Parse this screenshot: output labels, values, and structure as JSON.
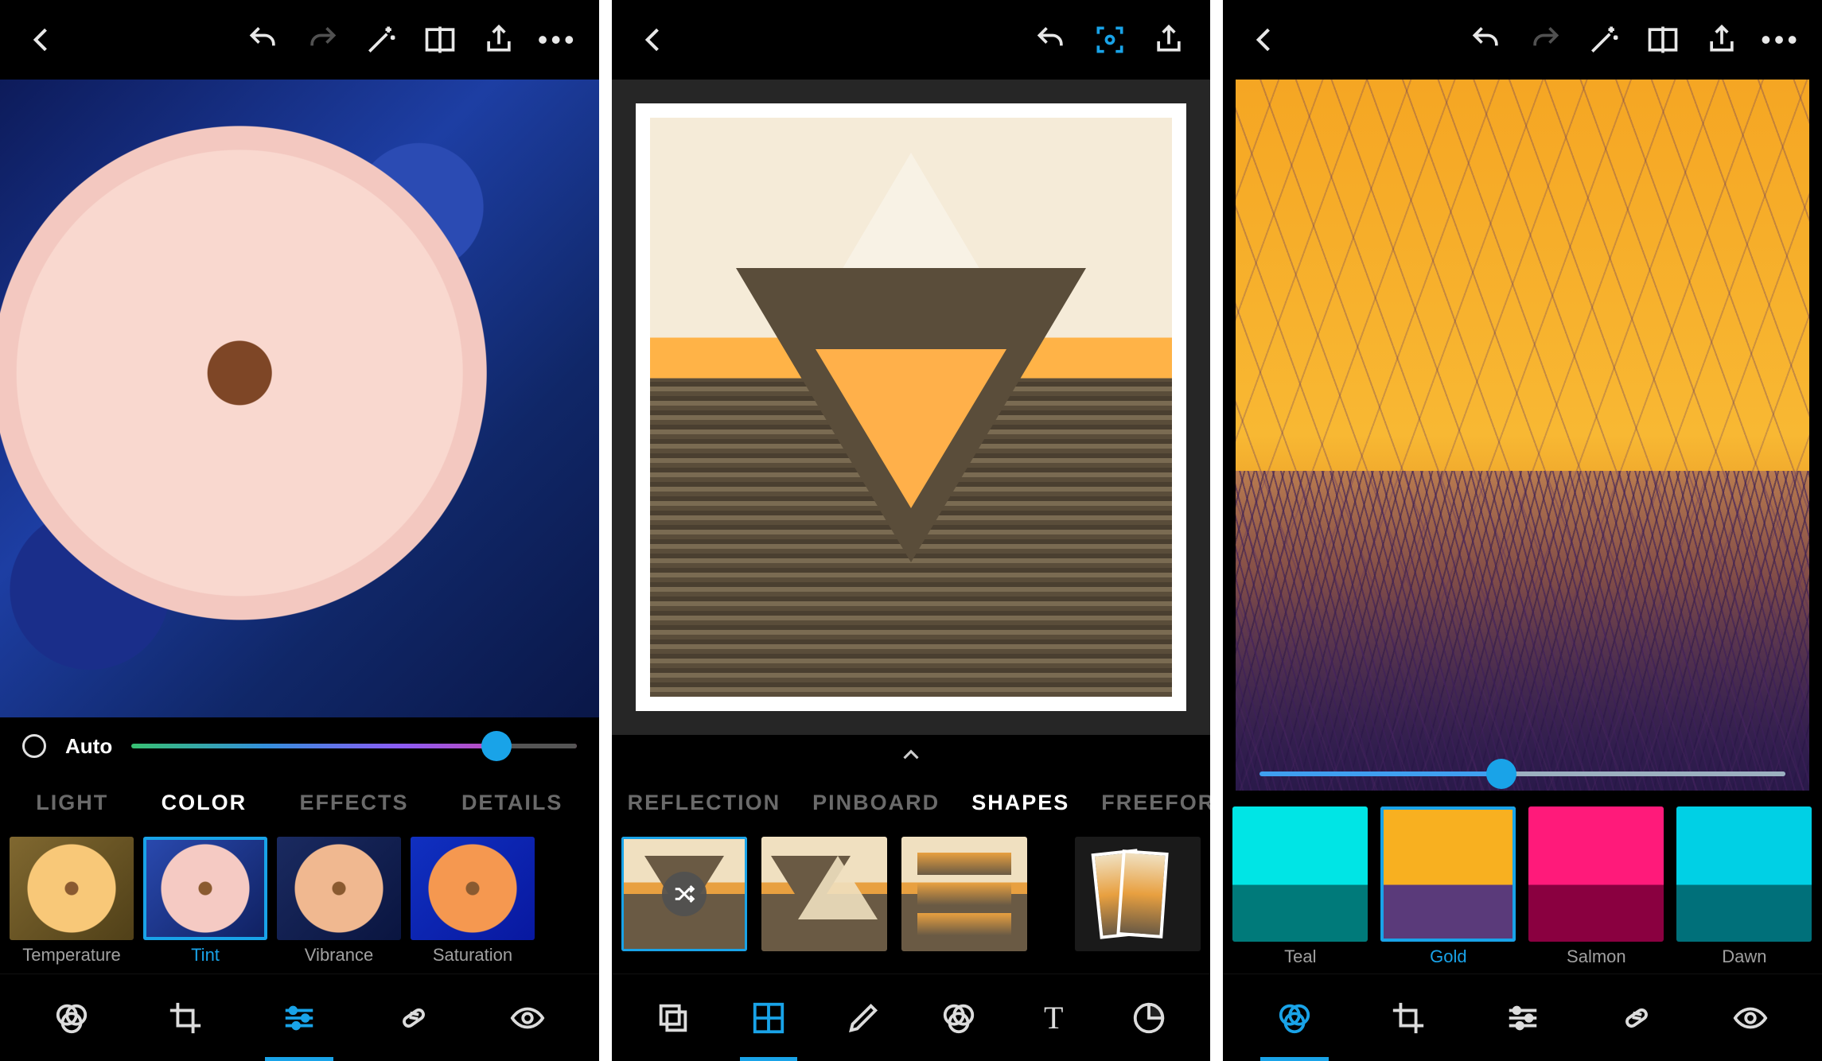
{
  "screens": [
    {
      "topbar": {
        "back": "back-icon",
        "undo": "undo-icon",
        "redo": "redo-icon",
        "magic": "magic-wand-icon",
        "compare": "compare-icon",
        "share": "share-icon",
        "more": "more-icon"
      },
      "auto_label": "Auto",
      "slider_value_pct": 82,
      "categories": [
        {
          "label": "LIGHT",
          "active": false
        },
        {
          "label": "COLOR",
          "active": true
        },
        {
          "label": "EFFECTS",
          "active": false
        },
        {
          "label": "DETAILS",
          "active": false
        }
      ],
      "thumbnails": [
        {
          "label": "Temperature",
          "variant": "temp",
          "selected": false
        },
        {
          "label": "Tint",
          "variant": "tint",
          "selected": true
        },
        {
          "label": "Vibrance",
          "variant": "vib",
          "selected": false
        },
        {
          "label": "Saturation",
          "variant": "sat",
          "selected": false
        }
      ],
      "bottom_tools": [
        {
          "name": "looks-icon",
          "active": false
        },
        {
          "name": "crop-icon",
          "active": false
        },
        {
          "name": "adjust-sliders-icon",
          "active": true
        },
        {
          "name": "heal-icon",
          "active": false
        },
        {
          "name": "eye-icon",
          "active": false
        }
      ]
    },
    {
      "topbar": {
        "back": "back-icon",
        "undo": "undo-icon",
        "focus": "focus-frame-icon",
        "share": "share-icon"
      },
      "categories": [
        {
          "label": "REFLECTION",
          "active": false
        },
        {
          "label": "PINBOARD",
          "active": false
        },
        {
          "label": "SHAPES",
          "active": true
        },
        {
          "label": "FREEFORMS",
          "active": false
        }
      ],
      "shape_thumbs": [
        {
          "name": "shape-triangle-down",
          "selected": true,
          "has_shuffle": true
        },
        {
          "name": "shape-triangle-pair",
          "selected": false
        },
        {
          "name": "shape-horizontal-bars",
          "selected": false
        },
        {
          "name": "shape-freeform-cards",
          "selected": false
        }
      ],
      "bottom_tools": [
        {
          "name": "layers-icon",
          "active": false
        },
        {
          "name": "collage-icon",
          "active": true
        },
        {
          "name": "pencil-icon",
          "active": false
        },
        {
          "name": "looks-icon",
          "active": false
        },
        {
          "name": "text-icon",
          "label": "T",
          "active": false
        },
        {
          "name": "sticker-icon",
          "active": false
        }
      ]
    },
    {
      "topbar": {
        "back": "back-icon",
        "undo": "undo-icon",
        "redo": "redo-icon",
        "magic": "magic-wand-icon",
        "compare": "compare-icon",
        "share": "share-icon",
        "more": "more-icon"
      },
      "slider_value_pct": 46,
      "filter_thumbs": [
        {
          "label": "Teal",
          "variant": "teal",
          "selected": false
        },
        {
          "label": "Gold",
          "variant": "gold",
          "selected": true
        },
        {
          "label": "Salmon",
          "variant": "salmon",
          "selected": false
        },
        {
          "label": "Dawn",
          "variant": "dawn",
          "selected": false
        }
      ],
      "bottom_tools": [
        {
          "name": "looks-icon",
          "active": true
        },
        {
          "name": "crop-icon",
          "active": false
        },
        {
          "name": "adjust-sliders-icon",
          "active": false
        },
        {
          "name": "heal-icon",
          "active": false
        },
        {
          "name": "eye-icon",
          "active": false
        }
      ]
    }
  ]
}
